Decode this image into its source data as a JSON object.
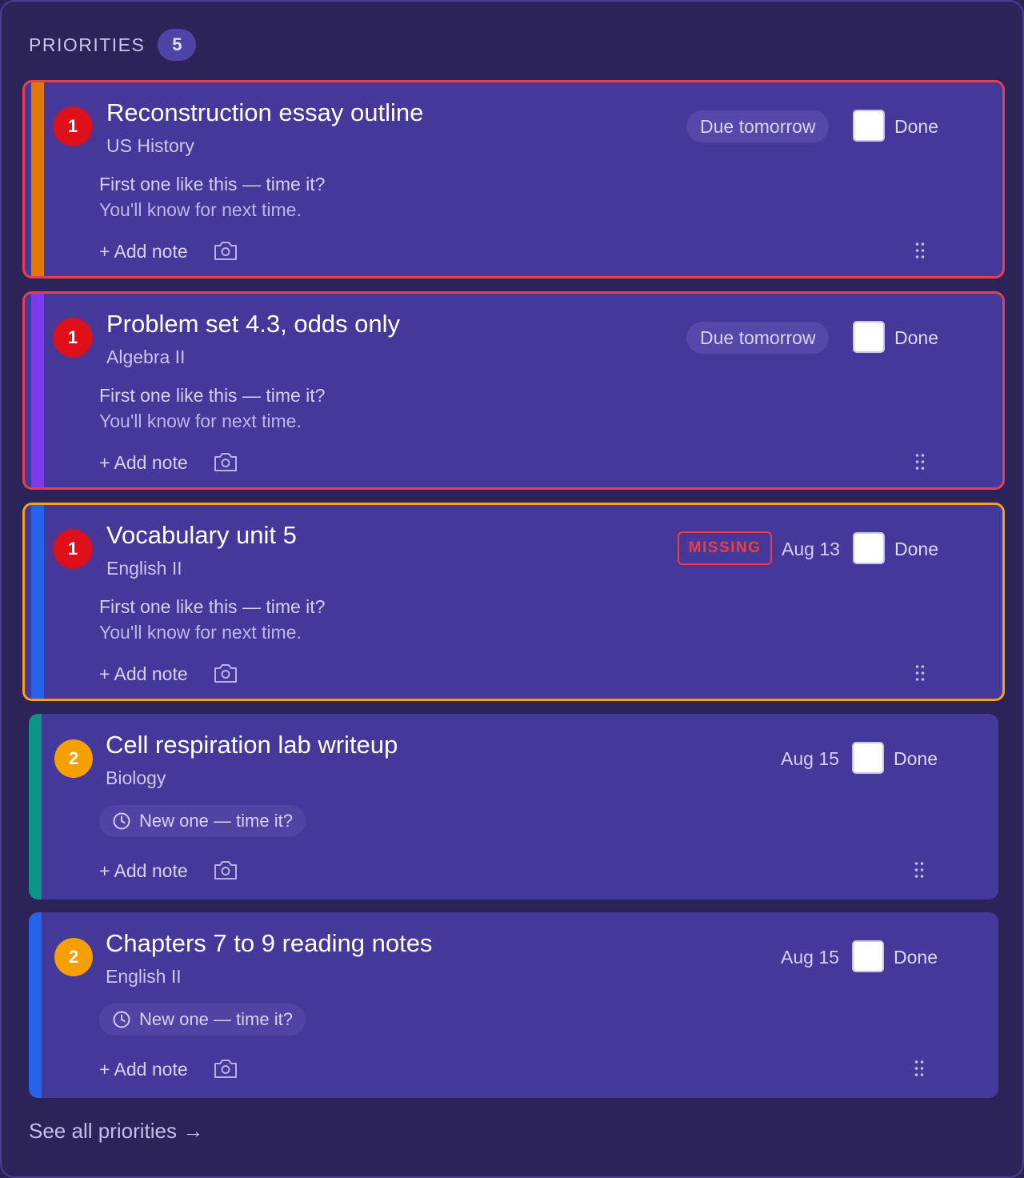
{
  "header": {
    "title": "PRIORITIES",
    "count": "5"
  },
  "colors": {
    "panel_bg": "#2c2358",
    "card_bg": "#44389a",
    "urgent_red": "#ea3d4a",
    "warning_orange": "#f5a015",
    "priority_1": "#e0101a",
    "priority_2": "#f5a000"
  },
  "cards": [
    {
      "priority": "1",
      "title": "Reconstruction essay outline",
      "subject": "US History",
      "due": "Due tomorrow",
      "done_label": "Done",
      "hint_line1": "First one like this — time it?",
      "hint_line2": "You'll know for next time.",
      "add_note": "+ Add note",
      "stripe_color": "#e0780a"
    },
    {
      "priority": "1",
      "title": "Problem set 4.3, odds only",
      "subject": "Algebra II",
      "due": "Due tomorrow",
      "done_label": "Done",
      "hint_line1": "First one like this — time it?",
      "hint_line2": "You'll know for next time.",
      "add_note": "+ Add note",
      "stripe_color": "#7c3aed"
    },
    {
      "priority": "1",
      "title": "Vocabulary unit 5",
      "subject": "English II",
      "status": "MISSING",
      "due": "Aug 13",
      "done_label": "Done",
      "hint_line1": "First one like this — time it?",
      "hint_line2": "You'll know for next time.",
      "add_note": "+ Add note",
      "stripe_color": "#2563eb"
    },
    {
      "priority": "2",
      "title": "Cell respiration lab writeup",
      "subject": "Biology",
      "due": "Aug 15",
      "done_label": "Done",
      "timer_label": "New one — time it?",
      "add_note": "+ Add note",
      "stripe_color": "#0d9488"
    },
    {
      "priority": "2",
      "title": "Chapters 7 to 9 reading notes",
      "subject": "English II",
      "due": "Aug 15",
      "done_label": "Done",
      "timer_label": "New one — time it?",
      "add_note": "+ Add note",
      "stripe_color": "#2563eb"
    }
  ],
  "footer": {
    "see_all": "See all priorities →"
  }
}
